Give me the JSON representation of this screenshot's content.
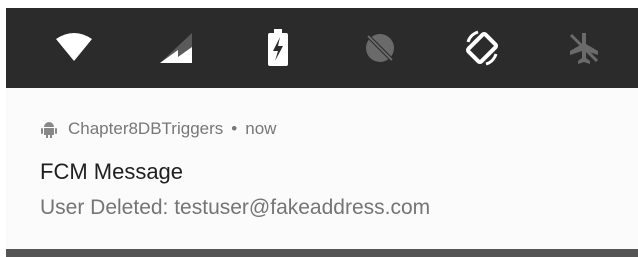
{
  "quick_settings": {
    "tiles": [
      {
        "name": "wifi",
        "icon": "wifi-icon",
        "state": "on"
      },
      {
        "name": "cellular",
        "icon": "cellular-signal-icon",
        "state": "on"
      },
      {
        "name": "battery",
        "icon": "battery-charging-icon",
        "state": "on"
      },
      {
        "name": "location",
        "icon": "location-off-icon",
        "state": "off"
      },
      {
        "name": "auto-rotate",
        "icon": "auto-rotate-icon",
        "state": "on"
      },
      {
        "name": "airplane",
        "icon": "airplane-mode-icon",
        "state": "off"
      }
    ],
    "colors": {
      "background": "#2b2b2b",
      "active": "#ffffff",
      "inactive": "#6a6a6a"
    }
  },
  "notification": {
    "app_icon": "android-icon",
    "app_name": "Chapter8DBTriggers",
    "separator": "•",
    "time": "now",
    "title": "FCM Message",
    "body": "User Deleted: testuser@fakeaddress.com"
  }
}
